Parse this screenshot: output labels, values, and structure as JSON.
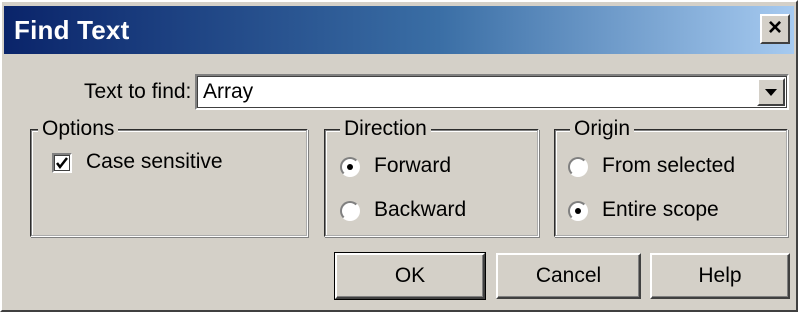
{
  "window": {
    "title": "Find Text",
    "close_icon": "close-icon"
  },
  "find": {
    "label": "Text to find:",
    "value": "Array",
    "dropdown_icon": "chevron-down-icon"
  },
  "options": {
    "title": "Options",
    "case_sensitive": {
      "label": "Case sensitive",
      "checked": true
    }
  },
  "direction": {
    "title": "Direction",
    "items": [
      {
        "label": "Forward",
        "selected": true
      },
      {
        "label": "Backward",
        "selected": false
      }
    ]
  },
  "origin": {
    "title": "Origin",
    "items": [
      {
        "label": "From selected",
        "selected": false
      },
      {
        "label": "Entire scope",
        "selected": true
      }
    ]
  },
  "buttons": {
    "ok": "OK",
    "cancel": "Cancel",
    "help": "Help"
  }
}
